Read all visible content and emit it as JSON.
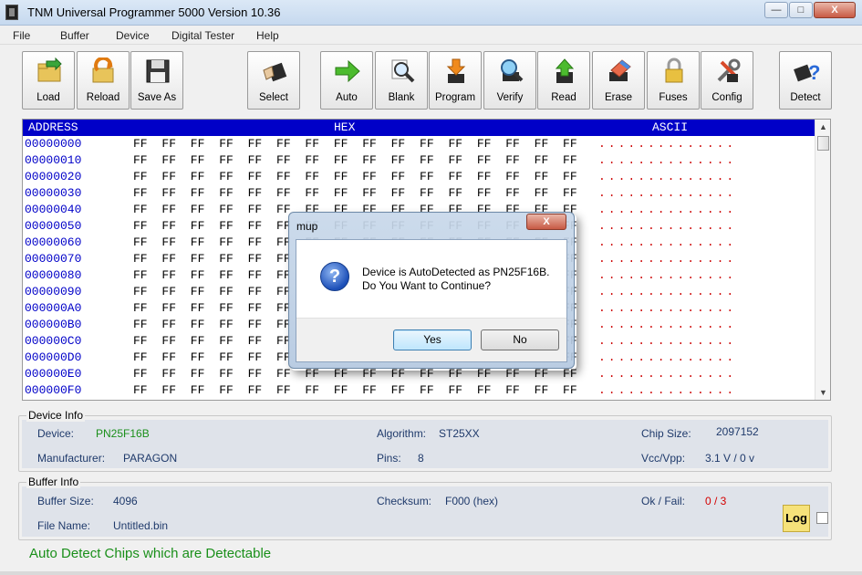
{
  "window": {
    "title": "TNM  Universal Programmer 5000   Version 10.36",
    "min_glyph": "—",
    "max_glyph": "□",
    "close_glyph": "X"
  },
  "menu": [
    "File",
    "Buffer",
    "Device",
    "Digital Tester",
    "Help"
  ],
  "toolbar": {
    "buttons": [
      {
        "label": "Load",
        "icon": "load-folder-icon"
      },
      {
        "label": "Reload",
        "icon": "reload-icon"
      },
      {
        "label": "Save As",
        "icon": "floppy-disk-icon"
      },
      {
        "label": "Select",
        "icon": "select-chip-icon"
      },
      {
        "label": "Auto",
        "icon": "green-arrow-icon"
      },
      {
        "label": "Blank",
        "icon": "magnifier-icon"
      },
      {
        "label": "Program",
        "icon": "program-download-icon"
      },
      {
        "label": "Verify",
        "icon": "verify-magnifier-icon"
      },
      {
        "label": "Read",
        "icon": "read-upload-icon"
      },
      {
        "label": "Erase",
        "icon": "eraser-icon"
      },
      {
        "label": "Fuses",
        "icon": "lock-icon"
      },
      {
        "label": "Config",
        "icon": "tools-icon"
      },
      {
        "label": "Detect",
        "icon": "detect-chip-icon"
      }
    ]
  },
  "hex": {
    "col_address": "ADDRESS",
    "col_hex": "HEX",
    "col_ascii": "ASCII",
    "rows": [
      {
        "addr": "00000000",
        "bytes": "FF FF FF FF FF FF FF FF FF FF FF FF FF FF FF FF",
        "ascii": ".............."
      },
      {
        "addr": "00000010",
        "bytes": "FF FF FF FF FF FF FF FF FF FF FF FF FF FF FF FF",
        "ascii": ".............."
      },
      {
        "addr": "00000020",
        "bytes": "FF FF FF FF FF FF FF FF FF FF FF FF FF FF FF FF",
        "ascii": ".............."
      },
      {
        "addr": "00000030",
        "bytes": "FF FF FF FF FF FF FF FF FF FF FF FF FF FF FF FF",
        "ascii": ".............."
      },
      {
        "addr": "00000040",
        "bytes": "FF FF FF FF FF FF FF FF FF FF FF FF FF FF FF FF",
        "ascii": ".............."
      },
      {
        "addr": "00000050",
        "bytes": "FF FF FF FF FF FF FF FF FF FF FF FF FF FF FF FF",
        "ascii": ".............."
      },
      {
        "addr": "00000060",
        "bytes": "FF FF FF FF FF FF FF FF FF FF FF FF FF FF FF FF",
        "ascii": ".............."
      },
      {
        "addr": "00000070",
        "bytes": "FF FF FF FF FF FF FF FF FF FF FF FF FF FF FF FF",
        "ascii": ".............."
      },
      {
        "addr": "00000080",
        "bytes": "FF FF FF FF FF FF FF FF FF FF FF FF FF FF FF FF",
        "ascii": ".............."
      },
      {
        "addr": "00000090",
        "bytes": "FF FF FF FF FF FF FF FF FF FF FF FF FF FF FF FF",
        "ascii": ".............."
      },
      {
        "addr": "000000A0",
        "bytes": "FF FF FF FF FF FF FF FF FF FF FF FF FF FF FF FF",
        "ascii": ".............."
      },
      {
        "addr": "000000B0",
        "bytes": "FF FF FF FF FF FF FF FF FF FF FF FF FF FF FF FF",
        "ascii": ".............."
      },
      {
        "addr": "000000C0",
        "bytes": "FF FF FF FF FF FF FF FF FF FF FF FF FF FF FF FF",
        "ascii": ".............."
      },
      {
        "addr": "000000D0",
        "bytes": "FF FF FF FF FF FF FF FF FF FF FF FF FF FF FF FF",
        "ascii": ".............."
      },
      {
        "addr": "000000E0",
        "bytes": "FF FF FF FF FF FF FF FF FF FF FF FF FF FF FF FF",
        "ascii": ".............."
      },
      {
        "addr": "000000F0",
        "bytes": "FF FF FF FF FF FF FF FF FF FF FF FF FF FF FF FF",
        "ascii": ".............."
      }
    ]
  },
  "device_info": {
    "title": "Device Info",
    "device_label": "Device:",
    "device_value": "PN25F16B",
    "algorithm_label": "Algorithm:",
    "algorithm_value": "ST25XX",
    "chip_size_label": "Chip Size:",
    "chip_size_value": "2097152",
    "manufacturer_label": "Manufacturer:",
    "manufacturer_value": "PARAGON",
    "pins_label": "Pins:",
    "pins_value": "8",
    "vcc_label": "Vcc/Vpp:",
    "vcc_value": "3.1 V / 0 v"
  },
  "buffer_info": {
    "title": "Buffer Info",
    "size_label": "Buffer Size:",
    "size_value": "4096",
    "checksum_label": "Checksum:",
    "checksum_value": "F000 (hex)",
    "okfail_label": "Ok / Fail:",
    "okfail_value": "0 / 3",
    "filename_label": "File Name:",
    "filename_value": "Untitled.bin",
    "log_label": "Log"
  },
  "status_text": "Auto Detect Chips which are Detectable",
  "dialog": {
    "title": "mup",
    "close_glyph": "X",
    "line1": "Device is AutoDetected as PN25F16B.",
    "line2": "Do You Want to Continue?",
    "yes_label": "Yes",
    "no_label": "No",
    "icon_glyph": "?"
  }
}
